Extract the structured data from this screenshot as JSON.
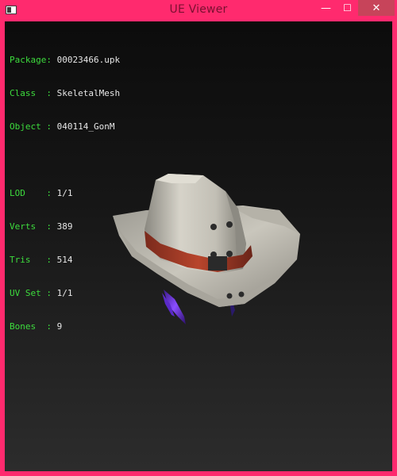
{
  "window": {
    "title": "UE Viewer",
    "minimize_glyph": "—",
    "maximize_glyph": "☐",
    "close_glyph": "✕"
  },
  "info": {
    "rows": [
      {
        "label": "Package",
        "value": "00023466.upk"
      },
      {
        "label": "Class  ",
        "value": "SkeletalMesh"
      },
      {
        "label": "Object ",
        "value": "040114_GonM"
      }
    ],
    "stats": [
      {
        "label": "LOD    ",
        "value": "1/1"
      },
      {
        "label": "Verts  ",
        "value": "389"
      },
      {
        "label": "Tris   ",
        "value": "514"
      },
      {
        "label": "UV Set ",
        "value": "1/1"
      },
      {
        "label": "Bones  ",
        "value": "9"
      }
    ],
    "separator": ": "
  },
  "colors": {
    "title_bar": "#ff2a6e",
    "label_green": "#3ddc3d",
    "value_text": "#e6e6e6",
    "viewport_bg": "#151515"
  },
  "icons": {
    "app": "app-window-icon",
    "minimize": "minimize-icon",
    "maximize": "maximize-icon",
    "close": "close-icon"
  }
}
